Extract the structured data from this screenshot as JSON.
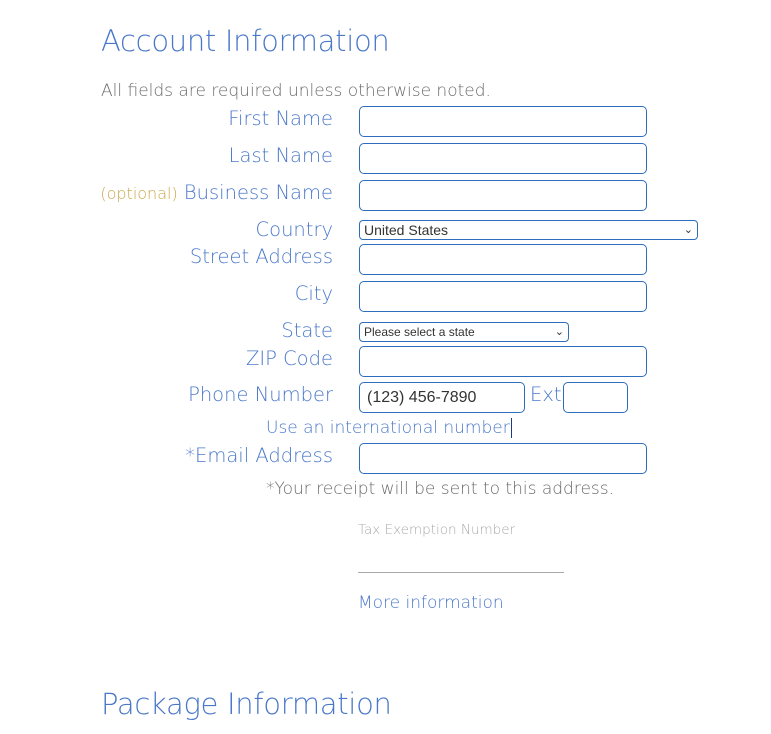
{
  "headings": {
    "account": "Account Information",
    "package": "Package Information"
  },
  "required_note": "All fields are required unless otherwise noted.",
  "fields": {
    "first_name": {
      "label": "First Name",
      "value": ""
    },
    "last_name": {
      "label": "Last Name",
      "value": ""
    },
    "business_name": {
      "optional": "(optional)",
      "label": "Business Name",
      "value": ""
    },
    "country": {
      "label": "Country",
      "value": "United States"
    },
    "street": {
      "label": "Street Address",
      "value": ""
    },
    "city": {
      "label": "City",
      "value": ""
    },
    "state": {
      "label": "State",
      "value": "Please select a state"
    },
    "zip": {
      "label": "ZIP Code",
      "value": ""
    },
    "phone": {
      "label": "Phone Number",
      "value": "(123) 456-7890",
      "ext_label": "Ext",
      "ext_value": ""
    },
    "international": "Use an international number",
    "email": {
      "label": "*Email Address",
      "value": "",
      "note": "*Your receipt will be sent to this address."
    },
    "tax": {
      "label": "Tax Exemption Number",
      "value": "",
      "more": "More information"
    }
  }
}
